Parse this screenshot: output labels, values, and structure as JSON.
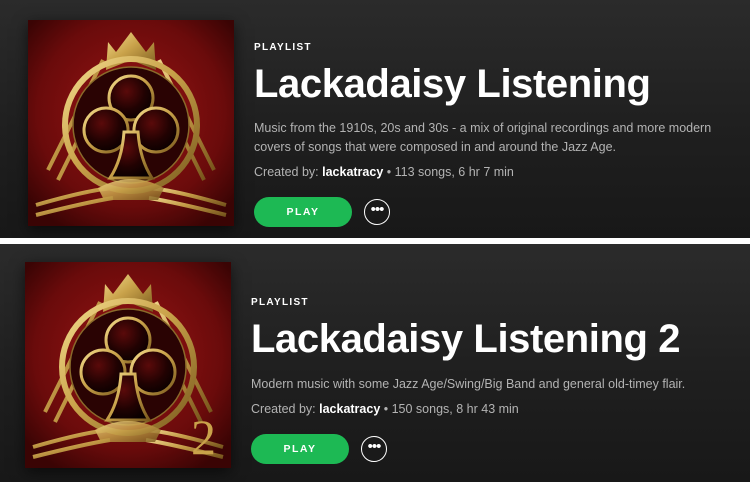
{
  "playlists": [
    {
      "kind": "PLAYLIST",
      "title": "Lackadaisy Listening",
      "description": "Music from the 1910s, 20s and 30s - a mix of original recordings and more modern covers of songs that were composed in and around the Jazz Age.",
      "created_by_label": "Created by:",
      "owner": "lackatracy",
      "stats": " • 113 songs, 6 hr 7 min",
      "play_label": "PLAY",
      "more_label": "•••",
      "cover_icon": "club-suit-icon",
      "cover_numeral": ""
    },
    {
      "kind": "PLAYLIST",
      "title": "Lackadaisy Listening 2",
      "description": "Modern music with some Jazz Age/Swing/Big Band and general old-timey flair.",
      "created_by_label": "Created by:",
      "owner": "lackatracy",
      "stats": " • 150 songs, 8 hr 43 min",
      "play_label": "PLAY",
      "more_label": "•••",
      "cover_icon": "club-suit-icon",
      "cover_numeral": "2"
    }
  ],
  "colors": {
    "accent_green": "#1db954",
    "cover_red": "#7a0d0d",
    "gold": "#c9a24a"
  }
}
